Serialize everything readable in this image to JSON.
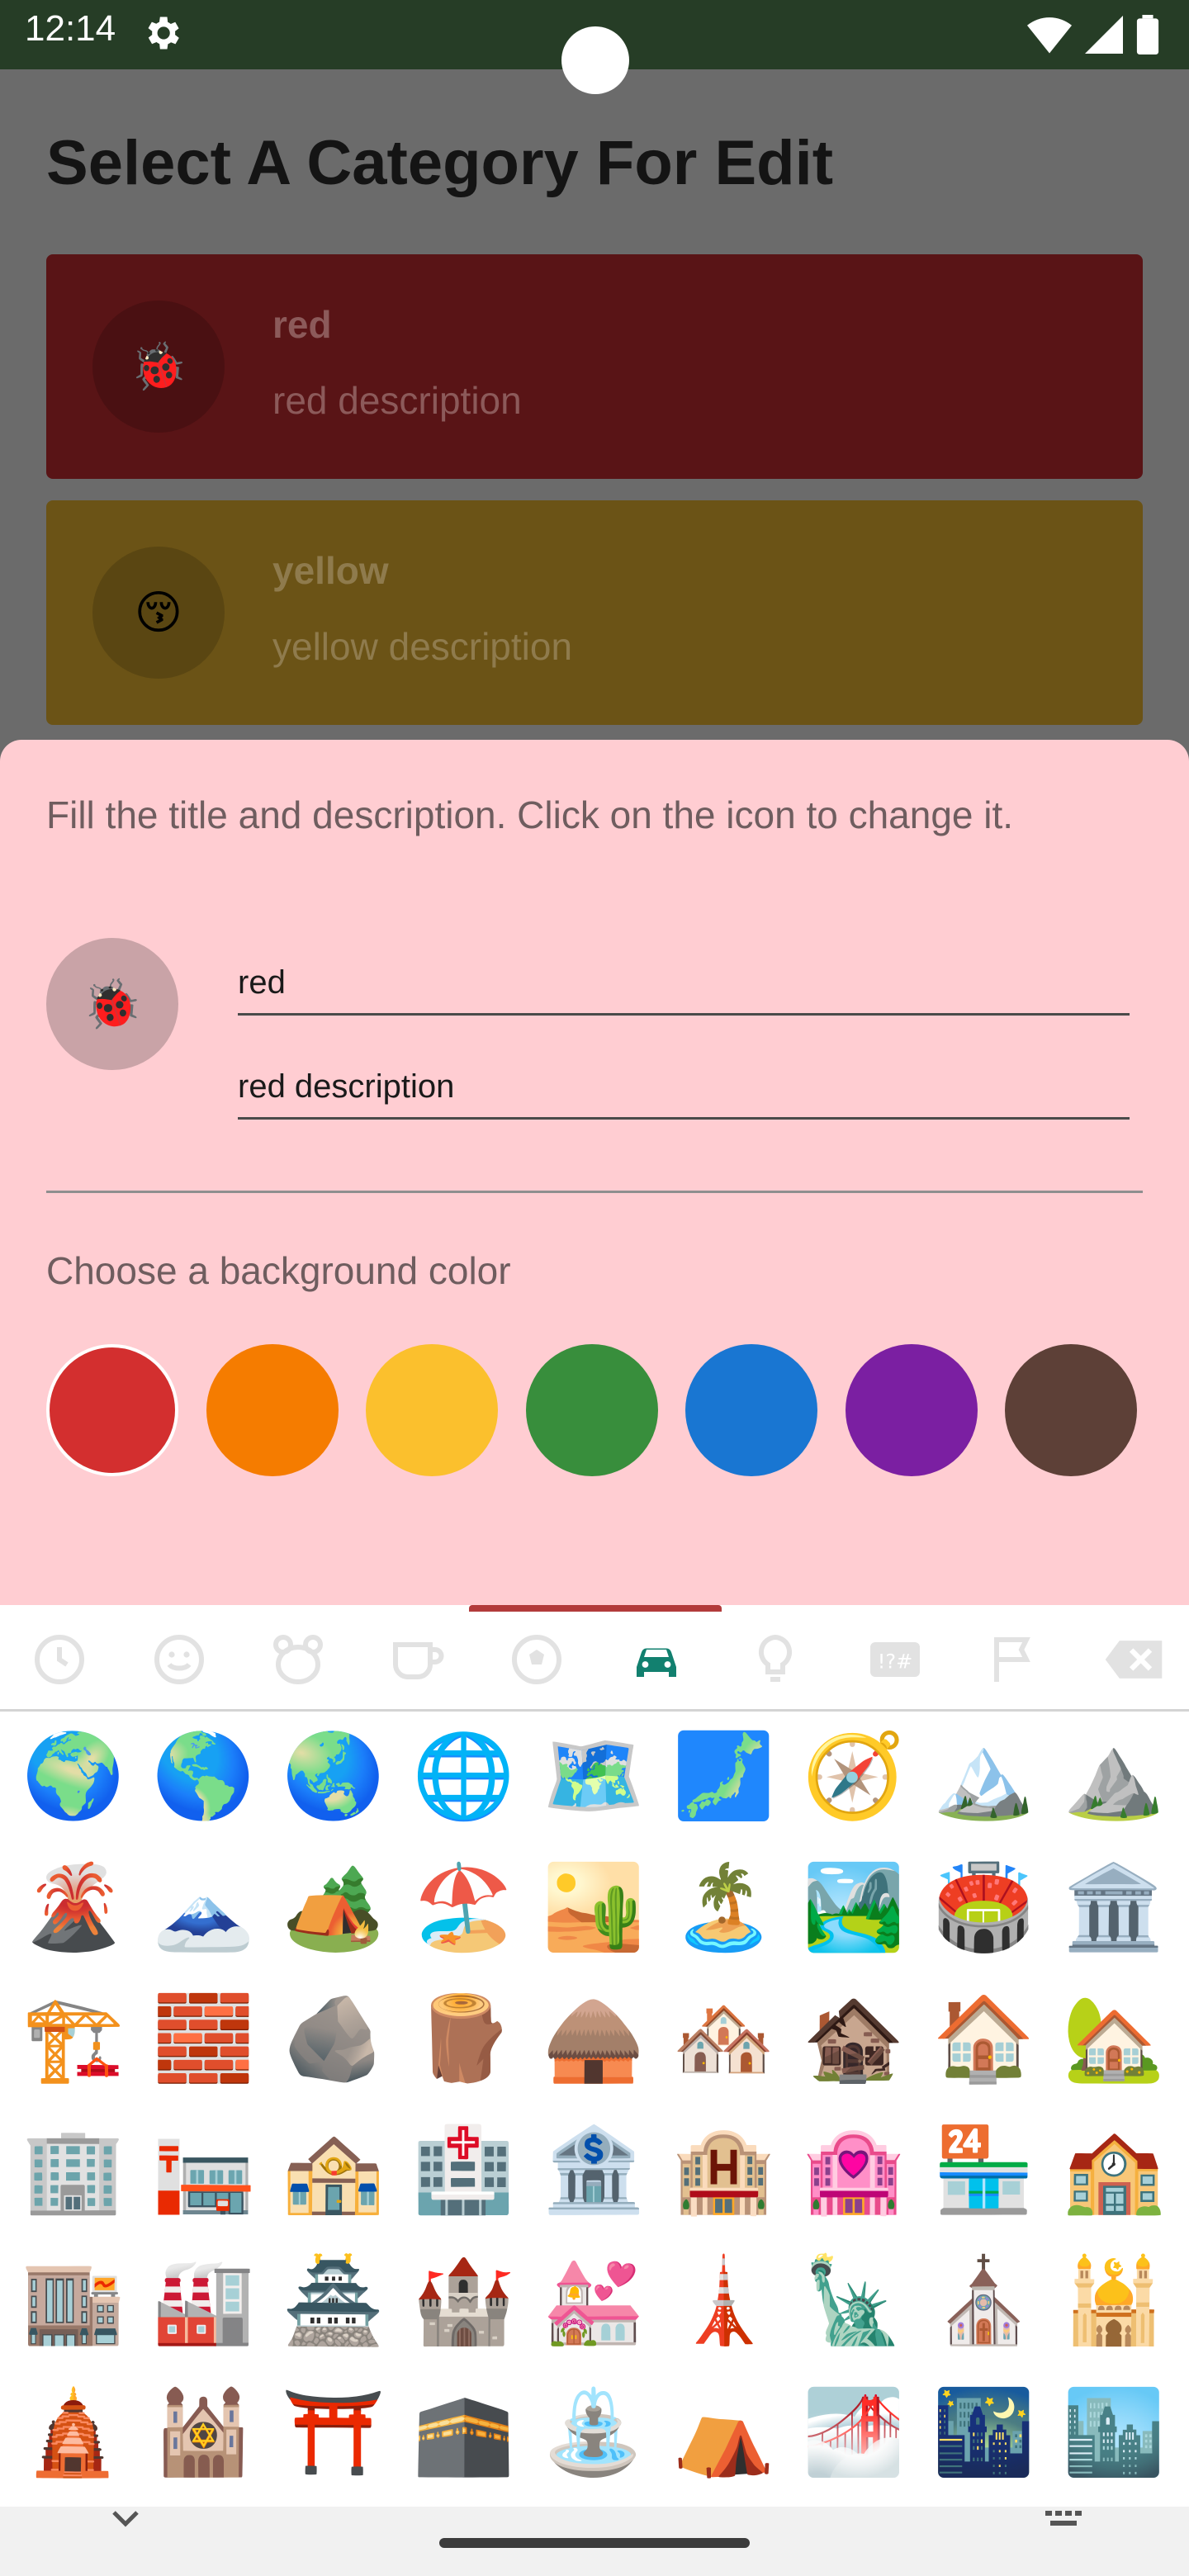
{
  "status_bar": {
    "time": "12:14"
  },
  "page": {
    "title": "Select A Category For Edit",
    "categories": [
      {
        "title": "red",
        "description": "red description",
        "icon": "🐞"
      },
      {
        "title": "yellow",
        "description": "yellow description",
        "icon": "😚"
      }
    ]
  },
  "sheet": {
    "instructions": "Fill the title and description. Click on the icon to change it.",
    "icon": "🐞",
    "title_value": "red",
    "description_value": "red description",
    "color_label": "Choose a background color",
    "colors": [
      "#d32f2f",
      "#f57c00",
      "#fbc02d",
      "#388e3c",
      "#1976d2",
      "#7b1fa2",
      "#5d4037"
    ],
    "selected_color": "#d32f2f"
  },
  "keyboard": {
    "tabs": [
      "recent-icon",
      "smileys-icon",
      "animals-icon",
      "food-icon",
      "activity-icon",
      "travel-icon",
      "objects-icon",
      "symbols-icon",
      "flags-icon",
      "backspace-icon"
    ],
    "active_tab": "travel-icon",
    "emojis": [
      [
        "🌍",
        "🌎",
        "🌏",
        "🌐",
        "🗺️",
        "🗾",
        "🧭",
        "🏔️",
        "⛰️"
      ],
      [
        "🌋",
        "🗻",
        "🏕️",
        "🏖️",
        "🏜️",
        "🏝️",
        "🏞️",
        "🏟️",
        "🏛️"
      ],
      [
        "🏗️",
        "🧱",
        "🪨",
        "🪵",
        "🛖",
        "🏘️",
        "🏚️",
        "🏠",
        "🏡"
      ],
      [
        "🏢",
        "🏣",
        "🏤",
        "🏥",
        "🏦",
        "🏨",
        "🏩",
        "🏪",
        "🏫"
      ],
      [
        "🏬",
        "🏭",
        "🏯",
        "🏰",
        "💒",
        "🗼",
        "🗽",
        "⛪",
        "🕌"
      ],
      [
        "🛕",
        "🕍",
        "⛩️",
        "🕋",
        "⛲",
        "⛺",
        "🌁",
        "🌃",
        "🏙️"
      ]
    ]
  }
}
